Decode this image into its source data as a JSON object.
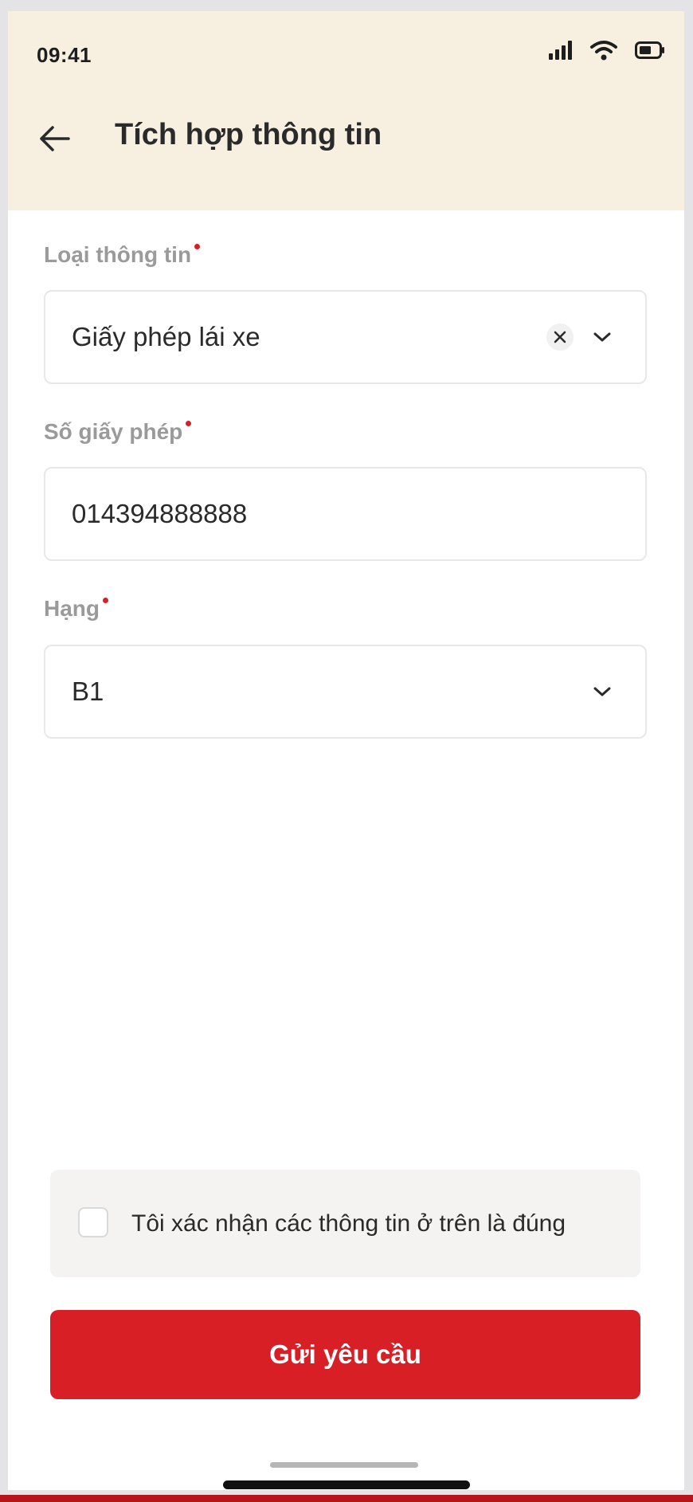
{
  "status_bar": {
    "time": "09:41",
    "icons": [
      "signal-icon",
      "wifi-icon",
      "battery-icon"
    ]
  },
  "header": {
    "title": "Tích hợp thông tin",
    "back_icon": "arrow-left-icon"
  },
  "form": {
    "info_type": {
      "label": "Loại thông tin",
      "value": "Giấy phép lái xe",
      "required": true
    },
    "license_number": {
      "label": "Số giấy phép",
      "value": "014394888888",
      "required": true
    },
    "license_class": {
      "label": "Hạng",
      "value": "B1",
      "required": true
    }
  },
  "confirm": {
    "label": "Tôi xác nhận các thông tin ở trên là đúng",
    "checked": false
  },
  "submit": {
    "label": "Gửi yêu cầu"
  },
  "colors": {
    "header_bg": "#f7efe0",
    "accent": "#d81f26",
    "label": "#9a9a9a",
    "text": "#2a2a2a"
  }
}
